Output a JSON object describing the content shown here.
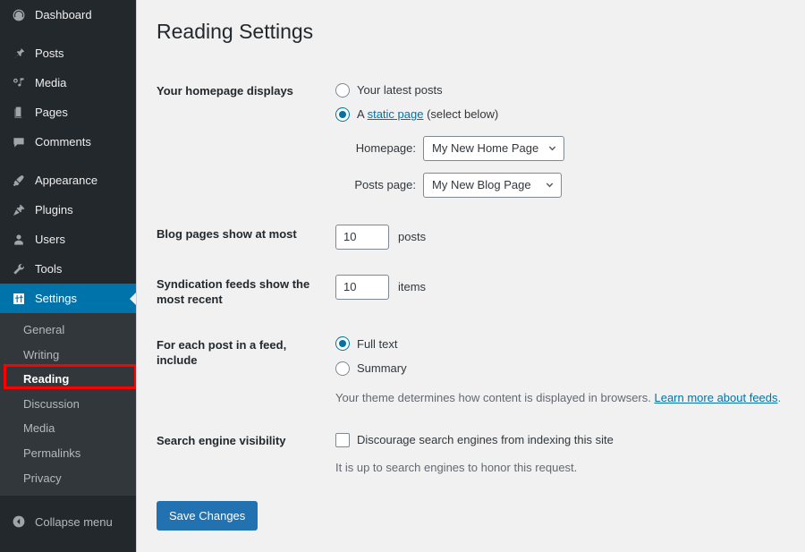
{
  "sidebar": {
    "items": [
      {
        "label": "Dashboard",
        "icon": "dashboard-icon"
      },
      {
        "label": "Posts",
        "icon": "pin-icon"
      },
      {
        "label": "Media",
        "icon": "media-icon"
      },
      {
        "label": "Pages",
        "icon": "pages-icon"
      },
      {
        "label": "Comments",
        "icon": "comment-icon"
      },
      {
        "label": "Appearance",
        "icon": "appearance-icon"
      },
      {
        "label": "Plugins",
        "icon": "plugin-icon"
      },
      {
        "label": "Users",
        "icon": "user-icon"
      },
      {
        "label": "Tools",
        "icon": "tools-icon"
      },
      {
        "label": "Settings",
        "icon": "settings-icon"
      }
    ],
    "submenu": [
      {
        "label": "General"
      },
      {
        "label": "Writing"
      },
      {
        "label": "Reading"
      },
      {
        "label": "Discussion"
      },
      {
        "label": "Media"
      },
      {
        "label": "Permalinks"
      },
      {
        "label": "Privacy"
      }
    ],
    "active_menu": "Settings",
    "active_submenu": "Reading",
    "collapse_label": "Collapse menu",
    "collapse_icon": "arrow-left-circle-icon",
    "colors": {
      "background": "#23282d",
      "submenu_background": "#32373c",
      "active": "#0073aa"
    }
  },
  "annotation": {
    "highlight_color": "#ff0000",
    "target": "Reading"
  },
  "page": {
    "title": "Reading Settings"
  },
  "homepage_displays": {
    "label": "Your homepage displays",
    "options": [
      {
        "label": "Your latest posts",
        "selected": false
      },
      {
        "label_prefix": "A ",
        "link_text": "static page",
        "label_suffix": " (select below)",
        "selected": true
      }
    ],
    "homepage_select": {
      "caption": "Homepage:",
      "value": "My New Home Page"
    },
    "posts_page_select": {
      "caption": "Posts page:",
      "value": "My New Blog Page"
    }
  },
  "blog_pages": {
    "label": "Blog pages show at most",
    "value": "10",
    "unit": "posts"
  },
  "syndication_feeds": {
    "label": "Syndication feeds show the most recent",
    "value": "10",
    "unit": "items"
  },
  "feed_include": {
    "label": "For each post in a feed, include",
    "options": [
      {
        "label": "Full text",
        "selected": true
      },
      {
        "label": "Summary",
        "selected": false
      }
    ],
    "description_prefix": "Your theme determines how content is displayed in browsers. ",
    "description_link": "Learn more about feeds",
    "description_suffix": "."
  },
  "search_engine_visibility": {
    "label": "Search engine visibility",
    "checkbox_label": "Discourage search engines from indexing this site",
    "checked": false,
    "description": "It is up to search engines to honor this request."
  },
  "submit": {
    "save_label": "Save Changes",
    "color": "#2271b1"
  }
}
